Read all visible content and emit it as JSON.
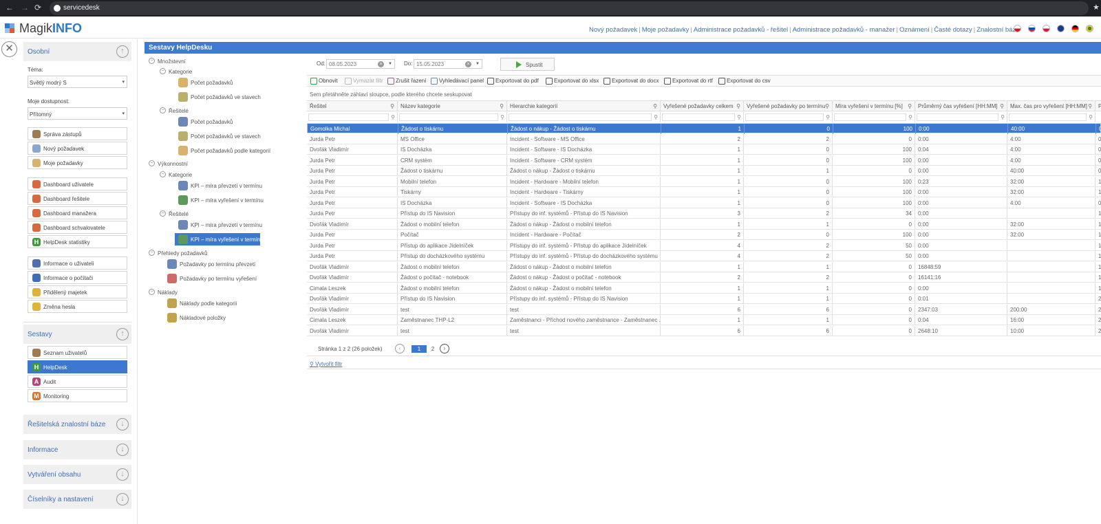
{
  "browser": {
    "url": "servicedesk",
    "back": "←",
    "forward": "→",
    "reload": "⟳",
    "star": "★"
  },
  "logo": {
    "part1": "Magik",
    "part2": "INFO"
  },
  "top_nav": [
    "Nový požadavek",
    "Moje požadavky",
    "Administrace požadavků - řešitel",
    "Administrace požadavků - manažer",
    "Oznámení",
    "Časté dotazy",
    "Znalostní báze"
  ],
  "top_nav_sep": "|",
  "sidebar": {
    "close": "✕",
    "osobni": "Osobní",
    "tema_label": "Téma:",
    "tema_value": "Světlý modrý S",
    "dostupnost_label": "Moje dostupnost:",
    "dostupnost_value": "Přítomný",
    "group1": [
      "Správa zástupů",
      "Nový požadavek",
      "Moje požadavky"
    ],
    "group2": [
      "Dashboard uživatele",
      "Dashboard řešitele",
      "Dashboard manažera",
      "Dashboard schvalovatele",
      "HelpDesk statistiky"
    ],
    "group3": [
      "Informace o uživateli",
      "Informace o počítači",
      "Přidělený majetek",
      "Změna hesla"
    ],
    "sestavy": "Sestavy",
    "sestavy_items": [
      "Seznam uživatelů",
      "HelpDesk",
      "Audit",
      "Monitoring"
    ],
    "sections": [
      "Řešitelská znalostní báze",
      "Informace",
      "Vytváření obsahu",
      "Číselníky a nastavení"
    ],
    "arrow_up": "↑",
    "arrow_down": "↓"
  },
  "main_title": "Sestavy HelpDesku",
  "tree": {
    "mnozstvi": "Množstevní",
    "kategorie": "Kategorie",
    "resitele": "Řešitelé",
    "vykonnostni": "Výkonnostní",
    "prehledy": "Přehledy požadavků",
    "naklady": "Náklady",
    "m_kat_items": [
      "Počet požadavků",
      "Počet požadavků ve stavech"
    ],
    "m_res_items": [
      "Počet požadavků",
      "Počet požadavků ve stavech",
      "Počet požadavků podle kategorií"
    ],
    "v_kat_items": [
      "KPI – míra převzetí v termínu",
      "KPI – míra vyřešení v termínu"
    ],
    "v_res_items": [
      "KPI – míra převzetí v termínu",
      "KPI – míra vyřešení v termínu"
    ],
    "prehledy_items": [
      "Požadavky po termínu převzetí",
      "Požadavky po termínu vyřešení"
    ],
    "naklady_items": [
      "Náklady podle kategorií",
      "Nákladové položky"
    ]
  },
  "filter": {
    "od_label": "Od:",
    "od_value": "08.05.2023",
    "do_label": "Do:",
    "do_value": "15.05.2023",
    "run": "Spustit",
    "clear": "×",
    "drop": "▼"
  },
  "toolbar": [
    "Obnovit",
    "Vymazat filtr",
    "Zrušit řazení",
    "Vyhledávací panel",
    "Exportovat do pdf",
    "Exportovat do xlsx",
    "Exportovat do docx",
    "Exportovat do rtf",
    "Exportovat do csv"
  ],
  "group_hint": "Sem přetáhněte záhlaví sloupce, podle kterého chcete seskupovat",
  "grid": {
    "pin": "⚲",
    "columns": [
      "Řešitel",
      "Název kategorie",
      "Hierarchie kategorií",
      "Vyřešené požadavky celkem",
      "Vyřešené požadavky po termínu",
      "Míra vyřešení v termínu [%]",
      "Průměrný čas vyřešení [HH:MM]",
      "Max. čas pro vyřešení [HH:MM]",
      "P"
    ],
    "rows": [
      [
        "Gomolka Michal",
        "Žádost o tiskárnu",
        "Žádost o nákup - Žádost o tiskárnu",
        "1",
        "0",
        "100",
        "0:00",
        "40:00",
        "0"
      ],
      [
        "Jurda Petr",
        "MS Office",
        "Incident - Software - MS Office",
        "2",
        "2",
        "0",
        "0:00",
        "4:00",
        "0"
      ],
      [
        "Dvořák Vladimír",
        "IS Docházka",
        "Incident - Software - IS Docházka",
        "1",
        "0",
        "100",
        "0:04",
        "4:00",
        "0"
      ],
      [
        "Jurda Petr",
        "CRM systém",
        "Incident - Software - CRM systém",
        "1",
        "0",
        "100",
        "0:00",
        "4:00",
        "0"
      ],
      [
        "Jurda Petr",
        "Žádost o tiskárnu",
        "Žádost o nákup - Žádost o tiskárnu",
        "1",
        "1",
        "0",
        "0:00",
        "40:00",
        "0"
      ],
      [
        "Jurda Petr",
        "Mobilní telefon",
        "Incident - Hardware - Mobilní telefon",
        "1",
        "0",
        "100",
        "0:23",
        "32:00",
        "1"
      ],
      [
        "Jurda Petr",
        "Tiskárny",
        "Incident - Hardware - Tiskárny",
        "1",
        "0",
        "100",
        "0:00",
        "32:00",
        "1"
      ],
      [
        "Jurda Petr",
        "IS Docházka",
        "Incident - Software - IS Docházka",
        "1",
        "0",
        "100",
        "0:00",
        "4:00",
        "0"
      ],
      [
        "Jurda Petr",
        "Přístup do IS Navision",
        "Přístupy do inf. systémů - Přístup do IS Navision",
        "3",
        "2",
        "34",
        "0:00",
        "",
        "1"
      ],
      [
        "Dvořák Vladimír",
        "Žádost o mobilní telefon",
        "Žádost o nákup - Žádost o mobilní telefon",
        "1",
        "1",
        "0",
        "0:00",
        "32:00",
        "1"
      ],
      [
        "Jurda Petr",
        "Počítač",
        "Incident - Hardware - Počítač",
        "2",
        "0",
        "100",
        "0:00",
        "32:00",
        "1"
      ],
      [
        "Jurda Petr",
        "Přístup do aplikace Jídelníček",
        "Přístupy do inf. systémů - Přístup do aplikace Jídelníček",
        "4",
        "2",
        "50",
        "0:00",
        "",
        "1"
      ],
      [
        "Jurda Petr",
        "Přístup do docházkového systému",
        "Přístupy do inf. systémů - Přístup do docházkového systému",
        "4",
        "2",
        "50",
        "0:00",
        "",
        "1"
      ],
      [
        "Dvořák Vladimír",
        "Žádost o mobilní telefon",
        "Žádost o nákup - Žádost o mobilní telefon",
        "1",
        "1",
        "0",
        "16848:59",
        "",
        "1"
      ],
      [
        "Dvořák Vladimír",
        "Žádost o počítač - notebook",
        "Žádost o nákup - Žádost o počítač - notebook",
        "2",
        "2",
        "0",
        "16141:16",
        "",
        "1"
      ],
      [
        "Cimala Leszek",
        "Žádost o mobilní telefon",
        "Žádost o nákup - Žádost o mobilní telefon",
        "1",
        "1",
        "0",
        "0:00",
        "",
        "1"
      ],
      [
        "Dvořák Vladimír",
        "Přístup do IS Navision",
        "Přístupy do inf. systémů - Přístup do IS Navision",
        "1",
        "1",
        "0",
        "0:01",
        "",
        "2"
      ],
      [
        "Dvořák Vladimír",
        "test",
        "test",
        "6",
        "6",
        "0",
        "2347:03",
        "200:00",
        "2"
      ],
      [
        "Cimala Leszek",
        "Zaměstnanec THP-L2",
        "Zaměstnanci - Příchod nového zaměstnance - Zaměstnanec ...",
        "1",
        "1",
        "0",
        "0:04",
        "16:00",
        "2"
      ],
      [
        "Dvořák Vladimír",
        "test",
        "test",
        "6",
        "6",
        "0",
        "2648:10",
        "10:00",
        "2"
      ]
    ]
  },
  "pager": {
    "info": "Stránka 1 z 2 (26 položek)",
    "page1": "1",
    "page2": "2",
    "prev": "‹",
    "next": "›"
  },
  "create_filter": "Vytvořit filtr",
  "colors": {
    "accent": "#3d78d0",
    "title_bar": "#3f7ad0",
    "link": "#3d6fb8"
  }
}
